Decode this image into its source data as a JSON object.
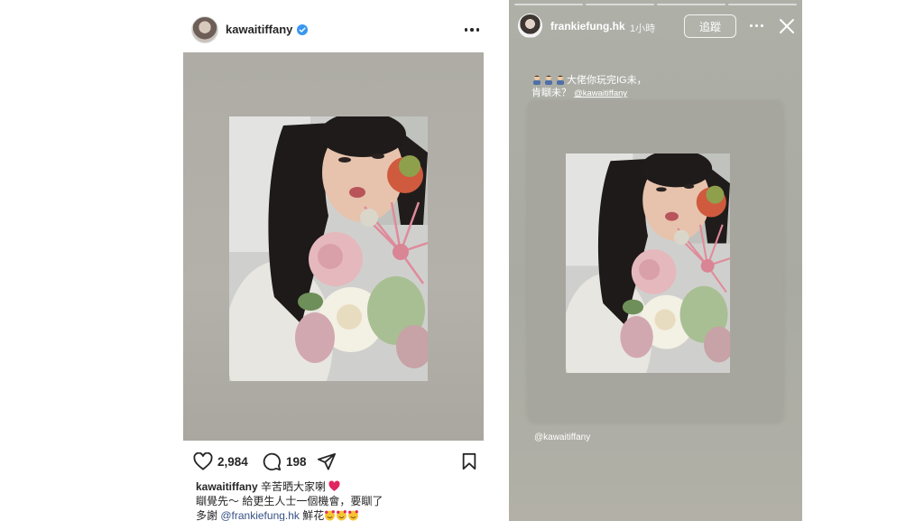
{
  "post": {
    "username": "kawaitiffany",
    "likes": "2,984",
    "comments": "198",
    "caption": {
      "user": "kawaitiffany",
      "line1": "辛苦晒大家喇",
      "line2": "瞓覺先～ 給更生人士一個機會，要瞓了",
      "line3_prefix": "多謝",
      "mention": "@frankiefung.hk",
      "line3_suffix": "鮮花"
    }
  },
  "story": {
    "username": "frankiefung.hk",
    "time": "1小時",
    "follow_label": "追蹤",
    "text_line1": "大佬你玩完IG未，",
    "text_line2_prefix": "肯瞓未？",
    "text_mention": "@kawaitiffany",
    "tag_mention": "@kawaitiffany",
    "progress_segments": 4
  },
  "colors": {
    "verified": "#3897f0",
    "heart": "#e0245e",
    "mention_link": "#385185"
  },
  "icons": [
    "verified-badge-icon",
    "more-icon",
    "heart-icon",
    "comment-icon",
    "share-icon",
    "bookmark-icon",
    "close-icon",
    "person-emoji-icon",
    "smiling-hearts-emoji-icon"
  ]
}
